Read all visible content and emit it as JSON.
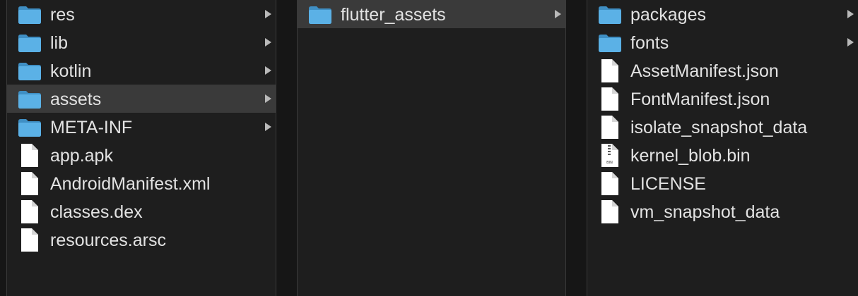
{
  "column1": {
    "items": [
      {
        "name": "res",
        "kind": "folder",
        "selected": false,
        "expandable": true
      },
      {
        "name": "lib",
        "kind": "folder",
        "selected": false,
        "expandable": true
      },
      {
        "name": "kotlin",
        "kind": "folder",
        "selected": false,
        "expandable": true
      },
      {
        "name": "assets",
        "kind": "folder",
        "selected": true,
        "expandable": true
      },
      {
        "name": "META-INF",
        "kind": "folder",
        "selected": false,
        "expandable": true
      },
      {
        "name": "app.apk",
        "kind": "file",
        "selected": false,
        "expandable": false
      },
      {
        "name": "AndroidManifest.xml",
        "kind": "file",
        "selected": false,
        "expandable": false
      },
      {
        "name": "classes.dex",
        "kind": "file",
        "selected": false,
        "expandable": false
      },
      {
        "name": "resources.arsc",
        "kind": "file",
        "selected": false,
        "expandable": false
      }
    ]
  },
  "column2": {
    "items": [
      {
        "name": "flutter_assets",
        "kind": "folder",
        "selected": true,
        "expandable": true
      }
    ]
  },
  "column3": {
    "items": [
      {
        "name": "packages",
        "kind": "folder",
        "selected": false,
        "expandable": true
      },
      {
        "name": "fonts",
        "kind": "folder",
        "selected": false,
        "expandable": true
      },
      {
        "name": "AssetManifest.json",
        "kind": "file",
        "selected": false,
        "expandable": false
      },
      {
        "name": "FontManifest.json",
        "kind": "file",
        "selected": false,
        "expandable": false
      },
      {
        "name": "isolate_snapshot_data",
        "kind": "file",
        "selected": false,
        "expandable": false
      },
      {
        "name": "kernel_blob.bin",
        "kind": "bin-file",
        "badge": "BIN",
        "selected": false,
        "expandable": false
      },
      {
        "name": "LICENSE",
        "kind": "file",
        "selected": false,
        "expandable": false
      },
      {
        "name": "vm_snapshot_data",
        "kind": "file",
        "selected": false,
        "expandable": false
      }
    ]
  },
  "icons": {
    "folder": "folder-icon",
    "file": "document-icon",
    "bin-file": "binary-file-icon",
    "chevron": "chevron-right-icon"
  },
  "colors": {
    "background": "#1e1e1e",
    "selection": "#3a3a3a",
    "text": "#e2e2e2",
    "folder_front": "#5bb1e6",
    "folder_back": "#3f8fc4",
    "file": "#ffffff",
    "chevron": "#b9b9b9"
  }
}
